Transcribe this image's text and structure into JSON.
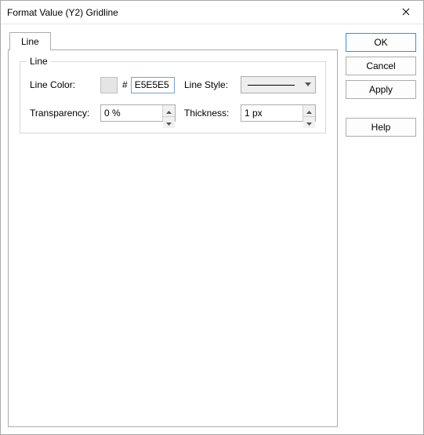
{
  "window": {
    "title": "Format Value (Y2) Gridline"
  },
  "tabs": {
    "line": "Line"
  },
  "group": {
    "title": "Line",
    "line_color_label": "Line Color:",
    "hash": "#",
    "hex_value": "E5E5E5",
    "swatch_color": "#E5E5E5",
    "line_style_label": "Line Style:",
    "transparency_label": "Transparency:",
    "transparency_value": "0 %",
    "thickness_label": "Thickness:",
    "thickness_value": "1 px"
  },
  "buttons": {
    "ok": "OK",
    "cancel": "Cancel",
    "apply": "Apply",
    "help": "Help"
  }
}
